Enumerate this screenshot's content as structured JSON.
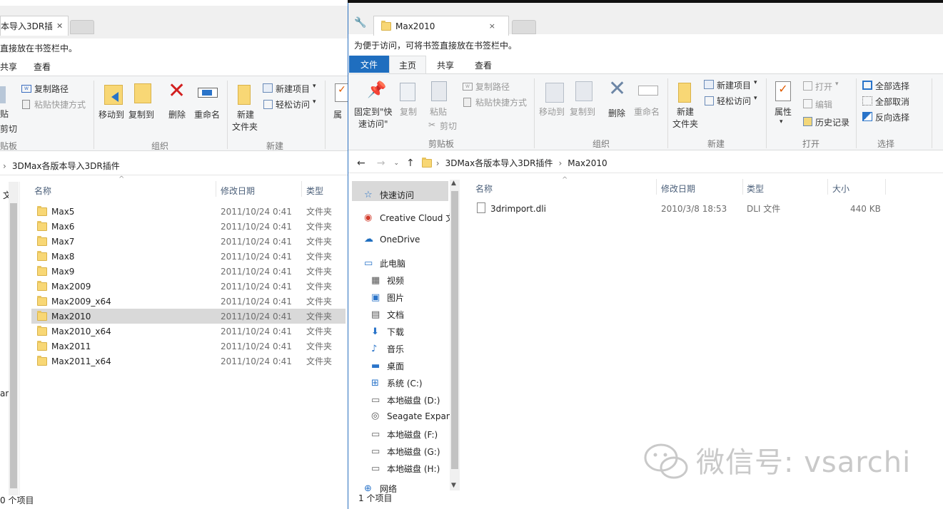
{
  "left_window": {
    "tab_title": "本导入3DR插",
    "hint": "直接放在书签栏中。",
    "menu": [
      "共享",
      "查看"
    ],
    "ribbon": {
      "paste_partial": "贴",
      "cut": "剪切",
      "copy_path": "复制路径",
      "paste_shortcut": "粘贴快捷方式",
      "move_to": "移动到",
      "copy_to": "复制到",
      "delete": "删除",
      "rename": "重命名",
      "new_folder_line1": "新建",
      "new_folder_line2": "文件夹",
      "new_item": "新建项目",
      "easy_access": "轻松访问",
      "properties_partial": "属",
      "group_clipboard": "贴板",
      "group_organize": "组织",
      "group_new": "新建"
    },
    "address": [
      "3DMax各版本导入3DR插件"
    ],
    "columns": {
      "name": "名称",
      "date": "修改日期",
      "type": "类型"
    },
    "nav_partial": [
      "文",
      "an"
    ],
    "rows": [
      {
        "name": "Max5",
        "date": "2011/10/24 0:41",
        "type": "文件夹"
      },
      {
        "name": "Max6",
        "date": "2011/10/24 0:41",
        "type": "文件夹"
      },
      {
        "name": "Max7",
        "date": "2011/10/24 0:41",
        "type": "文件夹"
      },
      {
        "name": "Max8",
        "date": "2011/10/24 0:41",
        "type": "文件夹"
      },
      {
        "name": "Max9",
        "date": "2011/10/24 0:41",
        "type": "文件夹"
      },
      {
        "name": "Max2009",
        "date": "2011/10/24 0:41",
        "type": "文件夹"
      },
      {
        "name": "Max2009_x64",
        "date": "2011/10/24 0:41",
        "type": "文件夹"
      },
      {
        "name": "Max2010",
        "date": "2011/10/24 0:41",
        "type": "文件夹"
      },
      {
        "name": "Max2010_x64",
        "date": "2011/10/24 0:41",
        "type": "文件夹"
      },
      {
        "name": "Max2011",
        "date": "2011/10/24 0:41",
        "type": "文件夹"
      },
      {
        "name": "Max2011_x64",
        "date": "2011/10/24 0:41",
        "type": "文件夹"
      }
    ],
    "selected_row": "Max2010",
    "status": "0 个项目"
  },
  "right_window": {
    "tab_title": "Max2010",
    "tab_close": "×",
    "hint": "为便于访问，可将书签直接放在书签栏中。",
    "menu": {
      "file": "文件",
      "home": "主页",
      "share": "共享",
      "view": "查看"
    },
    "ribbon": {
      "pin_line1": "固定到\"快",
      "pin_line2": "速访问\"",
      "copy": "复制",
      "paste": "粘贴",
      "copy_path": "复制路径",
      "paste_shortcut": "粘贴快捷方式",
      "cut": "剪切",
      "move_to": "移动到",
      "copy_to": "复制到",
      "delete": "删除",
      "rename": "重命名",
      "new_folder_line1": "新建",
      "new_folder_line2": "文件夹",
      "new_item": "新建项目",
      "easy_access": "轻松访问",
      "properties": "属性",
      "open": "打开",
      "edit": "编辑",
      "history": "历史记录",
      "select_all": "全部选择",
      "select_none": "全部取消",
      "invert_selection": "反向选择",
      "group_clipboard": "剪贴板",
      "group_organize": "组织",
      "group_new": "新建",
      "group_open": "打开",
      "group_select": "选择"
    },
    "address": [
      "3DMax各版本导入3DR插件",
      "Max2010"
    ],
    "nav": [
      {
        "label": "快速访问",
        "icon": "star-icon"
      },
      {
        "label": "Creative Cloud 文",
        "icon": "creative-cloud-icon"
      },
      {
        "label": "OneDrive",
        "icon": "cloud-icon"
      },
      {
        "label": "此电脑",
        "icon": "computer-icon"
      },
      {
        "label": "视频",
        "icon": "video-icon"
      },
      {
        "label": "图片",
        "icon": "picture-icon"
      },
      {
        "label": "文档",
        "icon": "document-icon"
      },
      {
        "label": "下载",
        "icon": "download-icon"
      },
      {
        "label": "音乐",
        "icon": "music-icon"
      },
      {
        "label": "桌面",
        "icon": "desktop-icon"
      },
      {
        "label": "系统 (C:)",
        "icon": "system-drive-icon"
      },
      {
        "label": "本地磁盘 (D:)",
        "icon": "drive-icon"
      },
      {
        "label": "Seagate Expan",
        "icon": "external-drive-icon"
      },
      {
        "label": "本地磁盘 (F:)",
        "icon": "drive-icon"
      },
      {
        "label": "本地磁盘 (G:)",
        "icon": "drive-icon"
      },
      {
        "label": "本地磁盘 (H:)",
        "icon": "drive-icon"
      },
      {
        "label": "网络",
        "icon": "network-icon"
      }
    ],
    "columns": {
      "name": "名称",
      "date": "修改日期",
      "type": "类型",
      "size": "大小"
    },
    "files": [
      {
        "name": "3drimport.dli",
        "date": "2010/3/8 18:53",
        "type": "DLI 文件",
        "size": "440 KB"
      }
    ],
    "status": "1 个项目"
  },
  "watermark": "微信号: vsarchi",
  "colors": {
    "accent": "#1f6ebf",
    "selection": "#d9d9d9",
    "folder": "#f8d775",
    "ribbon_bg": "#f5f6f7"
  }
}
